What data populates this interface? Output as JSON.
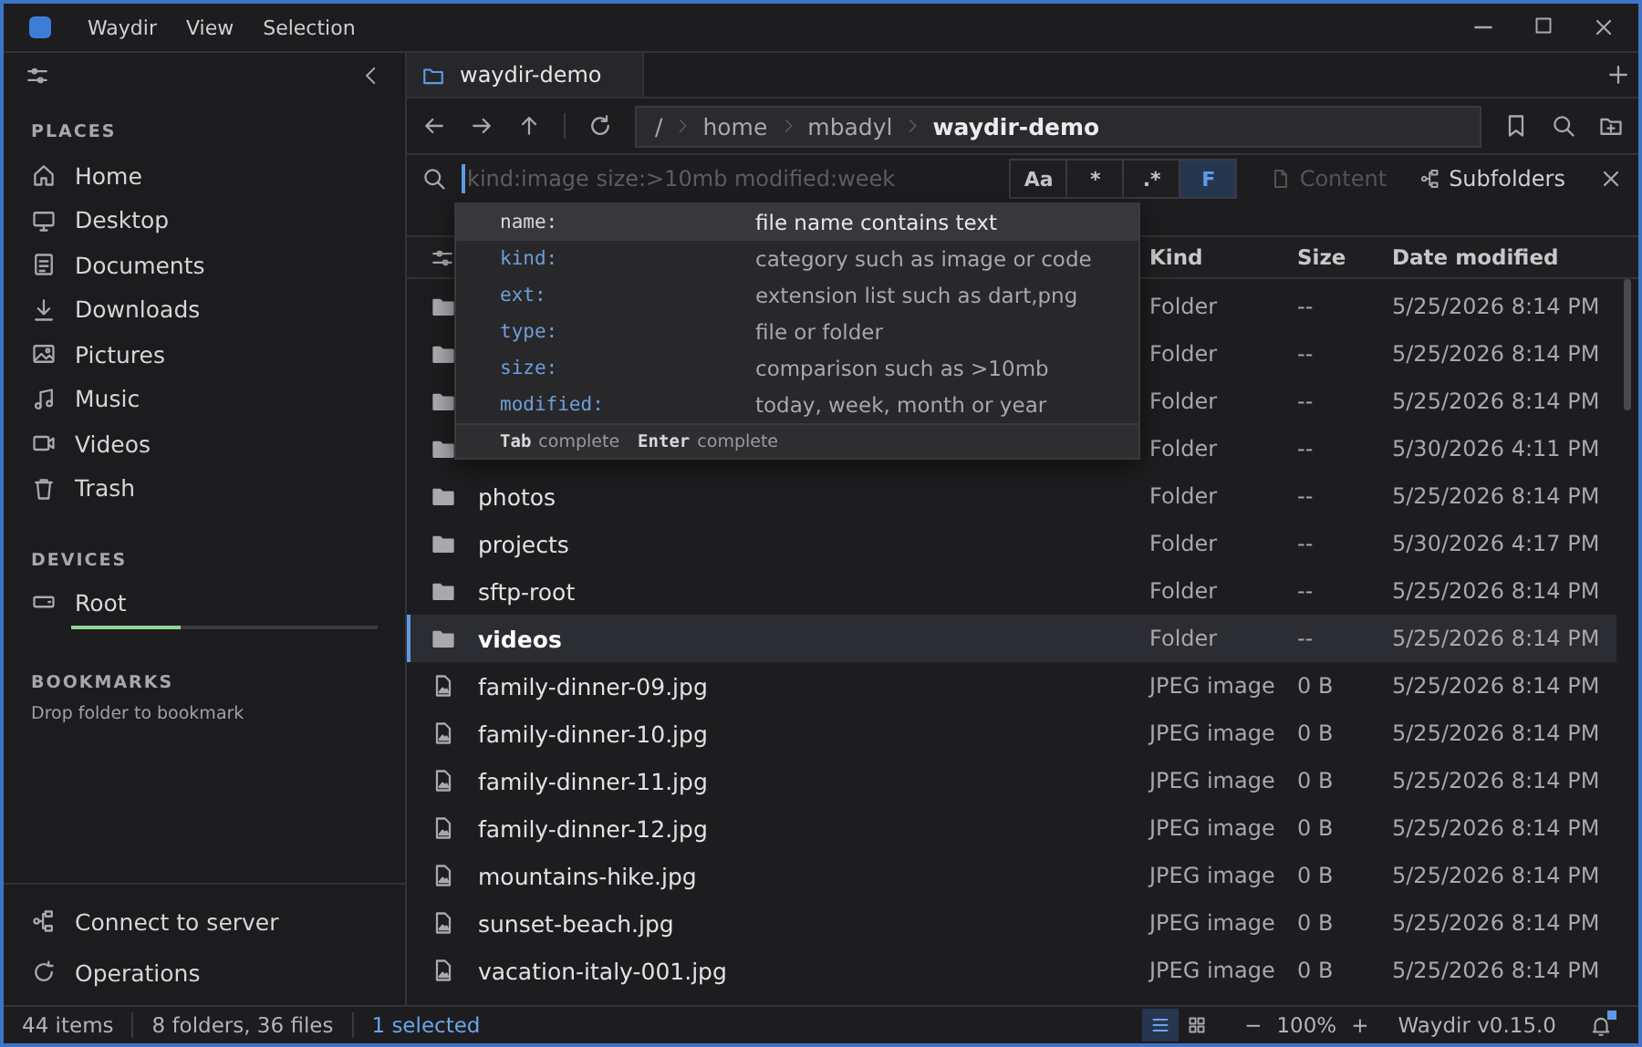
{
  "window": {
    "menu": [
      "Waydir",
      "View",
      "Selection"
    ]
  },
  "sidebar": {
    "sections": [
      {
        "title": "PLACES",
        "items": [
          {
            "label": "Home"
          },
          {
            "label": "Desktop"
          },
          {
            "label": "Documents"
          },
          {
            "label": "Downloads"
          },
          {
            "label": "Pictures"
          },
          {
            "label": "Music"
          },
          {
            "label": "Videos"
          },
          {
            "label": "Trash"
          }
        ]
      }
    ],
    "devices": {
      "title": "DEVICES",
      "items": [
        {
          "label": "Root",
          "level": 0.36
        }
      ]
    },
    "bookmarks": {
      "title": "BOOKMARKS",
      "hint": "Drop folder to bookmark"
    },
    "footer": [
      {
        "label": "Connect to server"
      },
      {
        "label": "Operations"
      }
    ]
  },
  "tabs": [
    {
      "label": "waydir-demo",
      "selected": true
    }
  ],
  "path": [
    "/",
    "home",
    "mbadyl",
    "waydir-demo"
  ],
  "search": {
    "placeholder": "kind:image size:>10mb modified:week",
    "toggles": [
      {
        "label": "Aa",
        "selected": false
      },
      {
        "label": "*",
        "selected": false
      },
      {
        "label": ".*",
        "selected": false
      },
      {
        "label": "F",
        "selected": true
      }
    ],
    "options": [
      {
        "label": "Content",
        "disabled": true
      },
      {
        "label": "Subfolders",
        "disabled": false
      }
    ]
  },
  "suggestions": [
    {
      "key": "name:",
      "desc": "file name contains text",
      "selected": true
    },
    {
      "key": "kind:",
      "desc": "category such as image or code",
      "selected": false
    },
    {
      "key": "ext:",
      "desc": "extension list such as dart,png",
      "selected": false
    },
    {
      "key": "type:",
      "desc": "file or folder",
      "selected": false
    },
    {
      "key": "size:",
      "desc": "comparison such as >10mb",
      "selected": false
    },
    {
      "key": "modified:",
      "desc": "today, week, month or year",
      "selected": false
    }
  ],
  "suggestion_hints": [
    {
      "key": "Tab",
      "action": "complete"
    },
    {
      "key": "Enter",
      "action": "complete"
    }
  ],
  "table": {
    "columns": [
      "Kind",
      "Size",
      "Date modified"
    ],
    "rows": [
      {
        "kind": "folder",
        "kind_label": "Folder",
        "size": "--",
        "modified": "5/25/2026 8:14 PM",
        "selected": false
      },
      {
        "kind": "folder",
        "kind_label": "Folder",
        "size": "--",
        "modified": "5/25/2026 8:14 PM",
        "selected": false
      },
      {
        "kind": "folder",
        "kind_label": "Folder",
        "size": "--",
        "modified": "5/25/2026 8:14 PM",
        "selected": false
      },
      {
        "kind": "folder",
        "kind_label": "Folder",
        "size": "--",
        "modified": "5/30/2026 4:11 PM",
        "selected": false
      },
      {
        "kind": "folder",
        "name": "photos",
        "kind_label": "Folder",
        "size": "--",
        "modified": "5/25/2026 8:14 PM",
        "selected": false
      },
      {
        "kind": "folder",
        "name": "projects",
        "kind_label": "Folder",
        "size": "--",
        "modified": "5/30/2026 4:17 PM",
        "selected": false
      },
      {
        "kind": "folder",
        "name": "sftp-root",
        "kind_label": "Folder",
        "size": "--",
        "modified": "5/25/2026 8:14 PM",
        "selected": false
      },
      {
        "kind": "folder",
        "name": "videos",
        "kind_label": "Folder",
        "size": "--",
        "modified": "5/25/2026 8:14 PM",
        "selected": true
      },
      {
        "kind": "image",
        "name": "family-dinner-09.jpg",
        "kind_label": "JPEG image",
        "size": "0 B",
        "modified": "5/25/2026 8:14 PM",
        "selected": false
      },
      {
        "kind": "image",
        "name": "family-dinner-10.jpg",
        "kind_label": "JPEG image",
        "size": "0 B",
        "modified": "5/25/2026 8:14 PM",
        "selected": false
      },
      {
        "kind": "image",
        "name": "family-dinner-11.jpg",
        "kind_label": "JPEG image",
        "size": "0 B",
        "modified": "5/25/2026 8:14 PM",
        "selected": false
      },
      {
        "kind": "image",
        "name": "family-dinner-12.jpg",
        "kind_label": "JPEG image",
        "size": "0 B",
        "modified": "5/25/2026 8:14 PM",
        "selected": false
      },
      {
        "kind": "image",
        "name": "mountains-hike.jpg",
        "kind_label": "JPEG image",
        "size": "0 B",
        "modified": "5/25/2026 8:14 PM",
        "selected": false
      },
      {
        "kind": "image",
        "name": "sunset-beach.jpg",
        "kind_label": "JPEG image",
        "size": "0 B",
        "modified": "5/25/2026 8:14 PM",
        "selected": false
      },
      {
        "kind": "image",
        "name": "vacation-italy-001.jpg",
        "kind_label": "JPEG image",
        "size": "0 B",
        "modified": "5/25/2026 8:14 PM",
        "selected": false
      }
    ]
  },
  "status_bar": {
    "count": "44 items",
    "summary": "8 folders, 36 files",
    "selection": "1 selected",
    "view_modes": [
      {
        "selected": true
      },
      {
        "selected": false
      }
    ],
    "zoom_out": "−",
    "zoom": "100%",
    "zoom_in": "+",
    "version": "Waydir v0.15.0",
    "notification": true
  }
}
